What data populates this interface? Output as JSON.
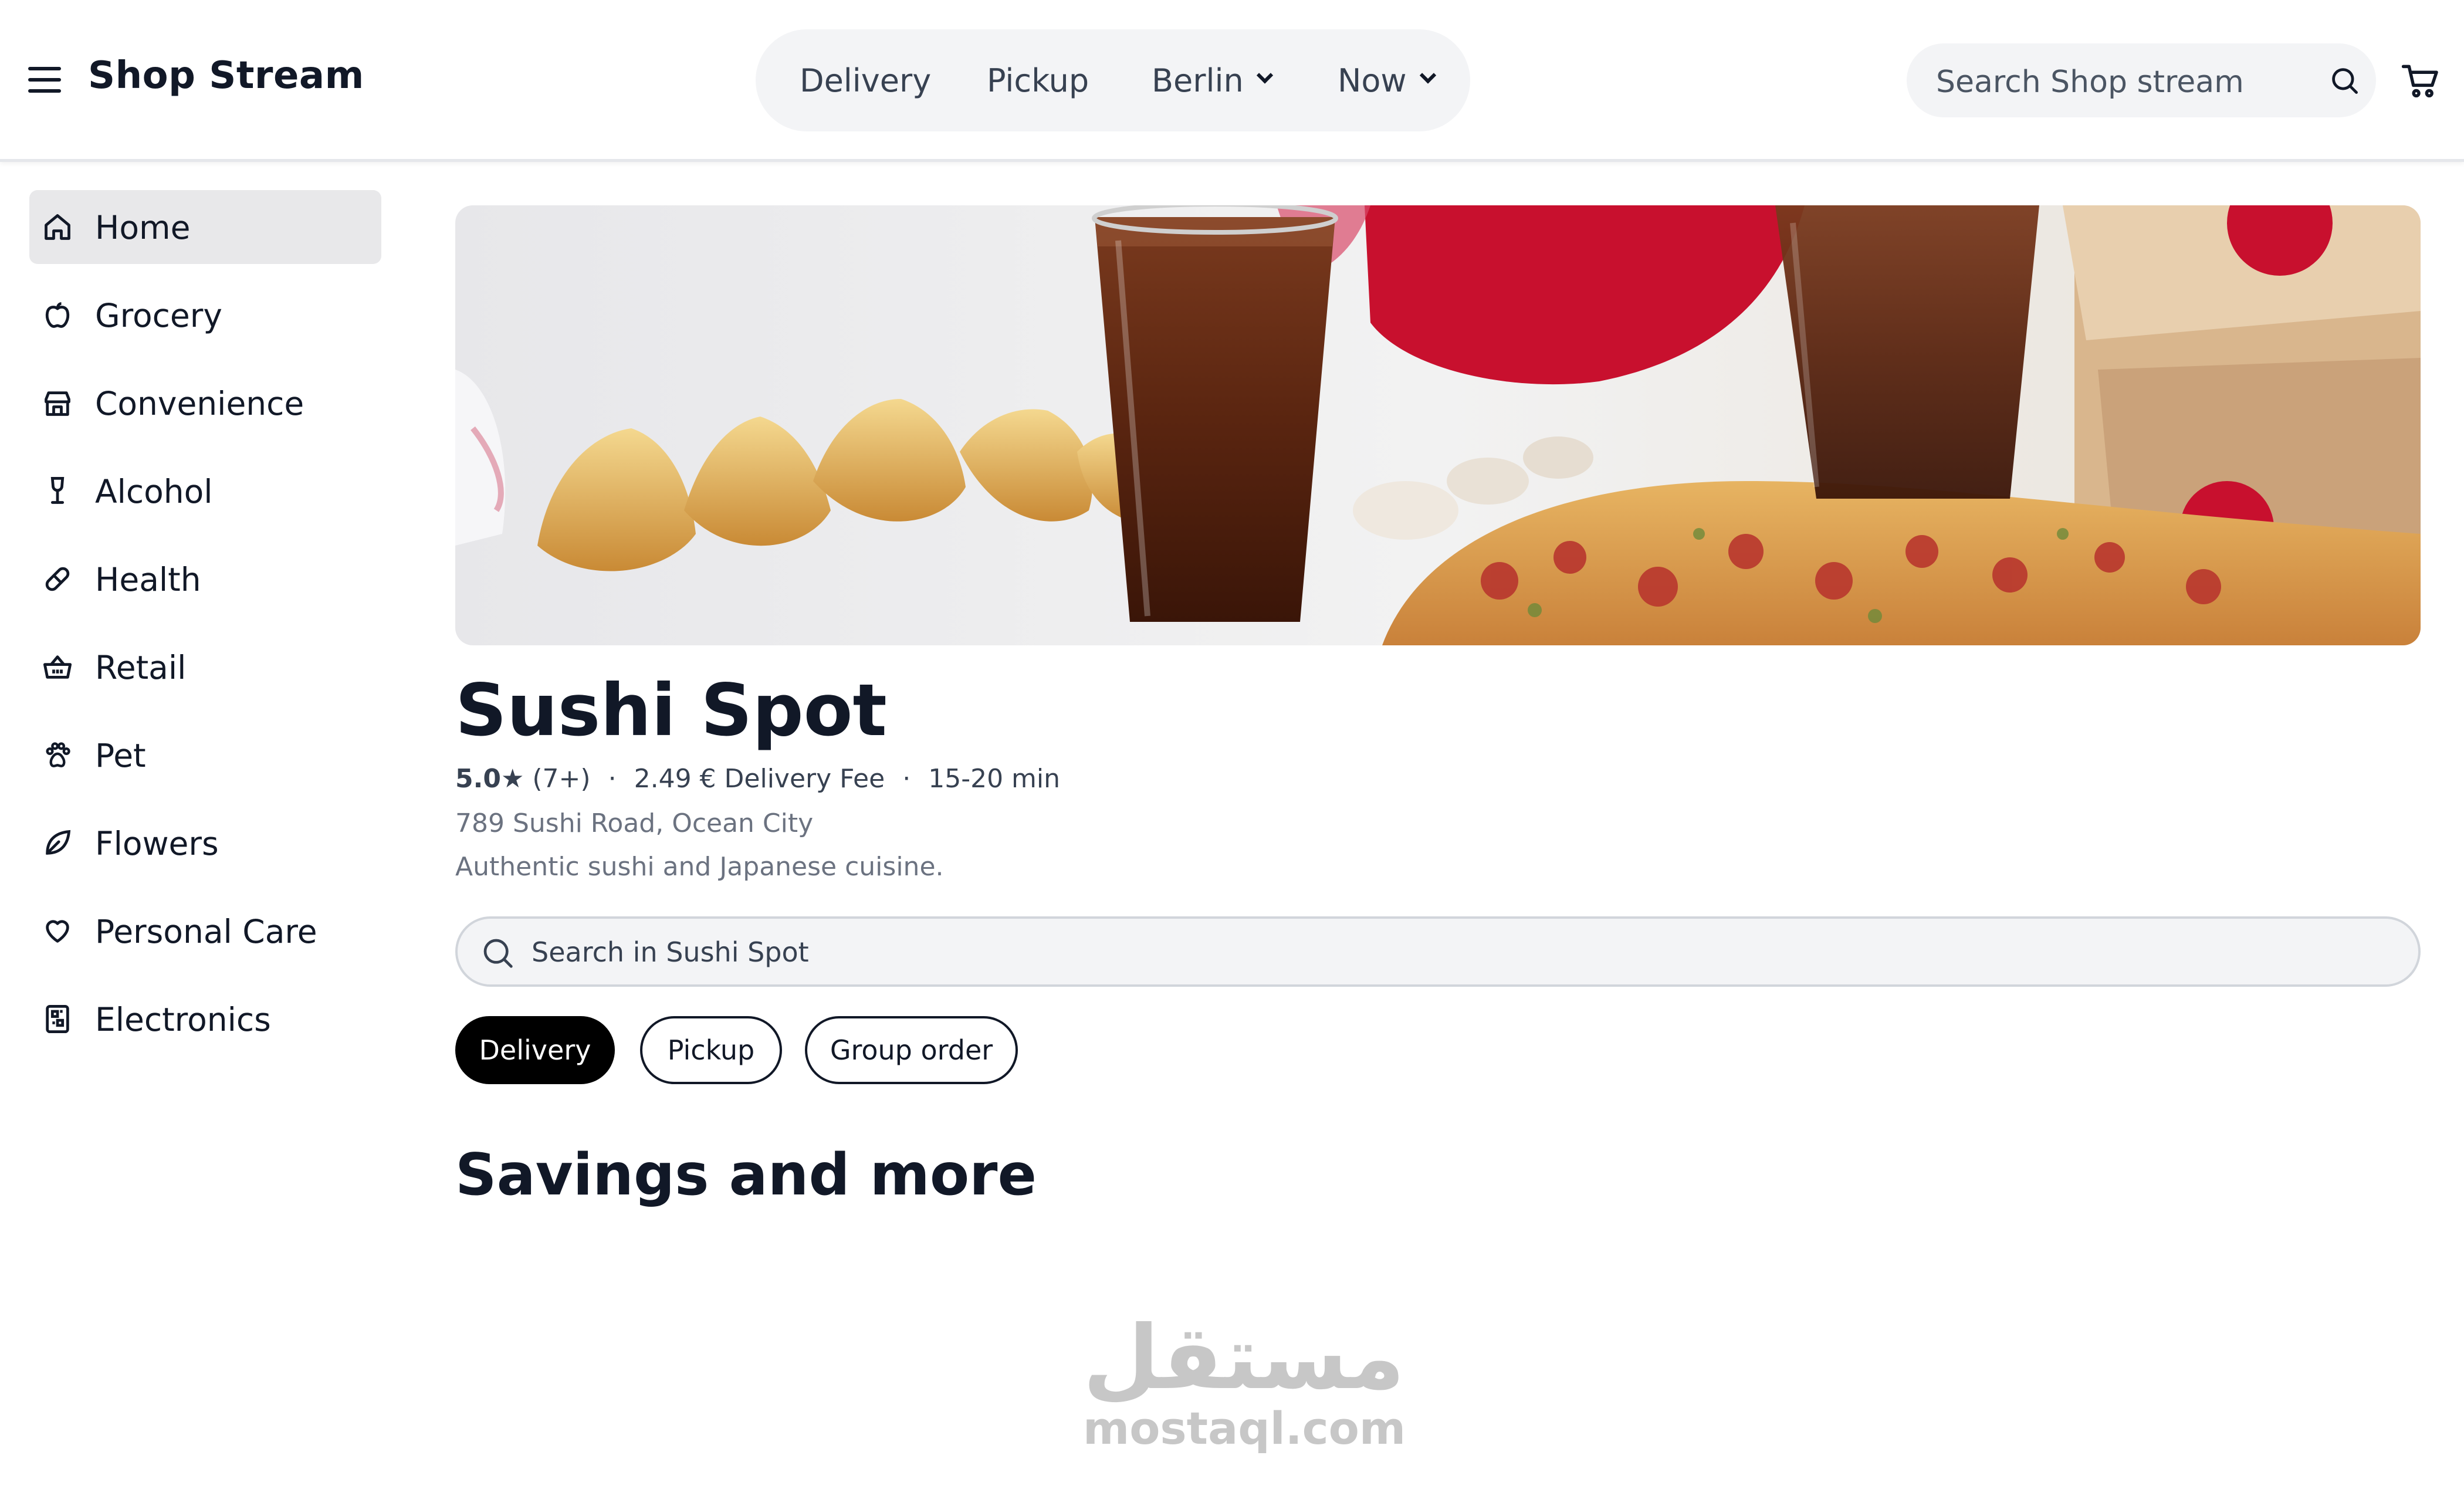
{
  "header": {
    "brand": "Shop Stream",
    "modes": [
      "Delivery",
      "Pickup",
      "Berlin",
      "Now"
    ],
    "search_placeholder": "Search Shop stream"
  },
  "sidebar": {
    "items": [
      {
        "label": "Home",
        "icon": "home-icon",
        "active": true
      },
      {
        "label": "Grocery",
        "icon": "apple-icon"
      },
      {
        "label": "Convenience",
        "icon": "store-icon"
      },
      {
        "label": "Alcohol",
        "icon": "wine-icon"
      },
      {
        "label": "Health",
        "icon": "pill-icon"
      },
      {
        "label": "Retail",
        "icon": "basket-icon"
      },
      {
        "label": "Pet",
        "icon": "paw-icon"
      },
      {
        "label": "Flowers",
        "icon": "leaf-icon"
      },
      {
        "label": "Personal Care",
        "icon": "heart-icon"
      },
      {
        "label": "Electronics",
        "icon": "device-icon"
      }
    ]
  },
  "store": {
    "name": "Sushi Spot",
    "rating": "5.0★",
    "reviews": "(7+)",
    "delivery_fee": "2.49 € Delivery Fee",
    "eta": "15-20 min",
    "separator": "·",
    "address": "789 Sushi Road, Ocean City",
    "description": "Authentic sushi and Japanese cuisine.",
    "search_placeholder": "Search in Sushi Spot",
    "order_modes": [
      "Delivery",
      "Pickup",
      "Group order"
    ],
    "active_mode": "Delivery"
  },
  "sections": {
    "savings_title": "Savings and more"
  },
  "watermark": {
    "arabic": "مستقل",
    "latin": "mostaql.com"
  },
  "colors": {
    "accent_red": "#c8102e",
    "active_chip": "#000000",
    "sidebar_active": "#e8e8ea"
  }
}
